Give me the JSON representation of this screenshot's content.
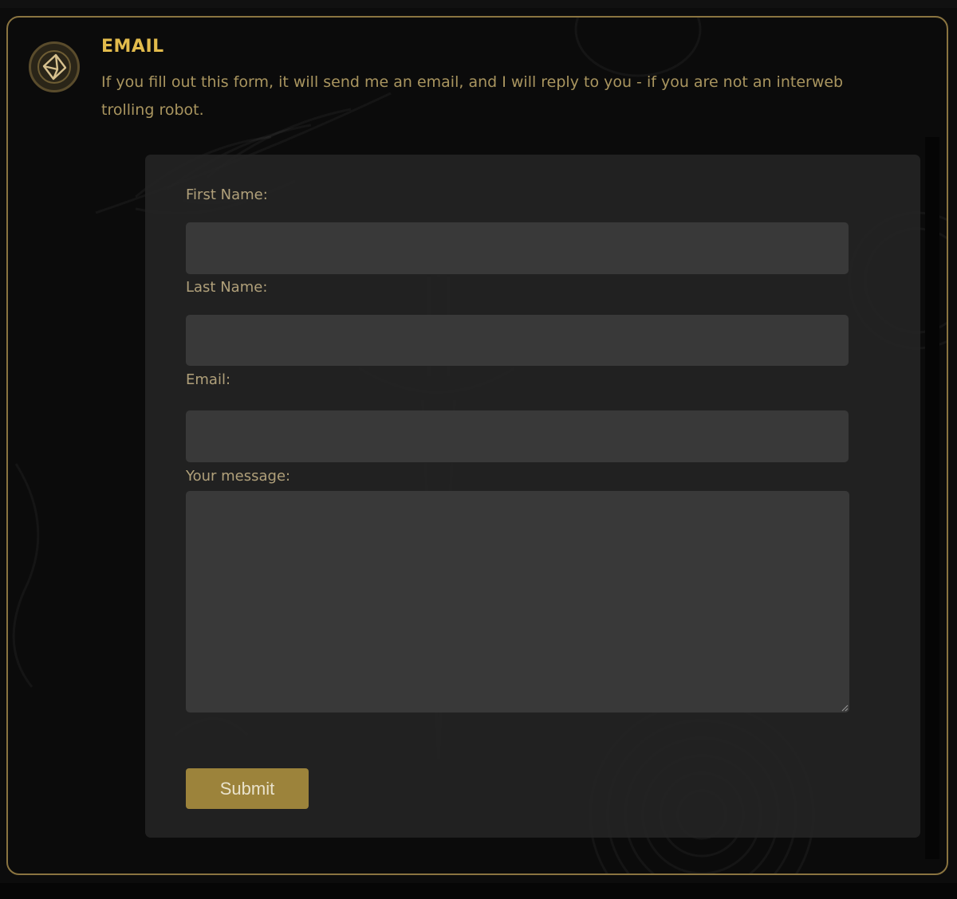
{
  "header": {
    "icon": "envelope-icon",
    "title": "EMAIL",
    "description": "If you fill out this form, it will send me an email, and I will reply to you - if you are not an interweb trolling robot."
  },
  "form": {
    "first_name": {
      "label": "First Name:",
      "value": ""
    },
    "last_name": {
      "label": "Last Name:",
      "value": ""
    },
    "email": {
      "label": "Email:",
      "value": ""
    },
    "message": {
      "label": "Your message:",
      "value": ""
    },
    "submit_label": "Submit"
  },
  "colors": {
    "accent_gold": "#e2bb4c",
    "text_gold": "#a9955f",
    "button": "#9c833b",
    "border": "#8a7440",
    "panel": "#232323",
    "input": "#393939"
  }
}
